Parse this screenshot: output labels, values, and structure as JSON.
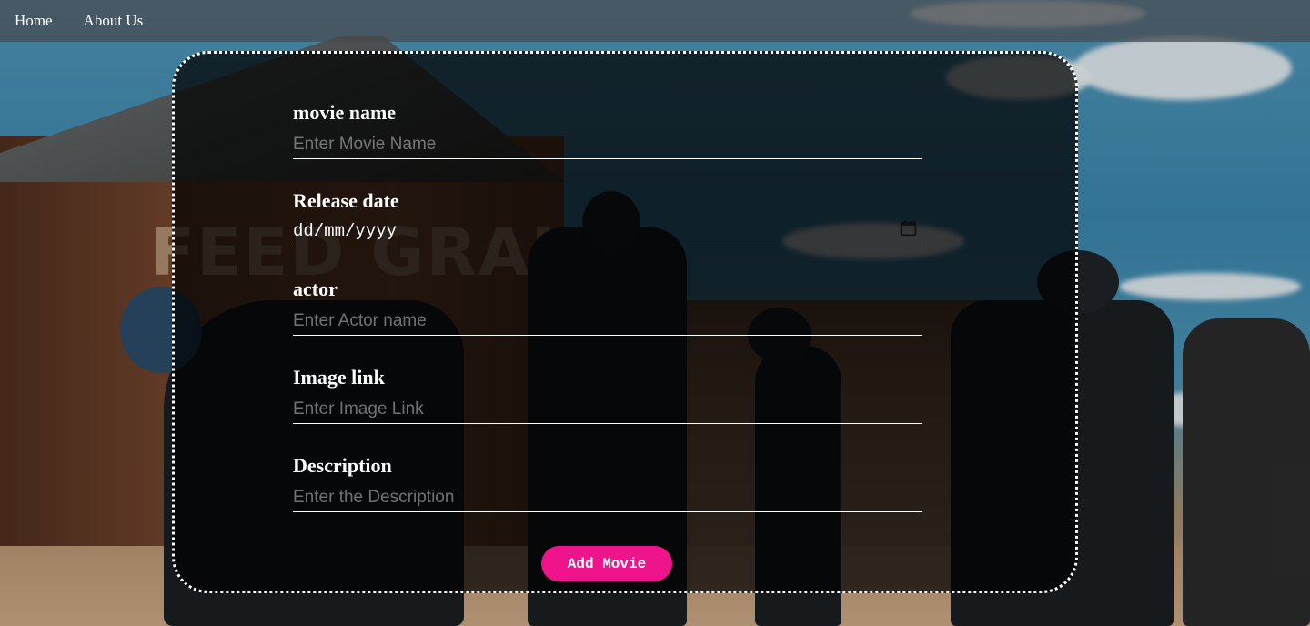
{
  "nav": {
    "items": [
      {
        "label": "Home"
      },
      {
        "label": "About Us"
      }
    ]
  },
  "form": {
    "fields": [
      {
        "label": "movie name",
        "placeholder": "Enter Movie Name"
      },
      {
        "label": "Release date",
        "placeholder": "dd/mm/yyyy"
      },
      {
        "label": "actor",
        "placeholder": "Enter Actor name"
      },
      {
        "label": "Image link",
        "placeholder": "Enter Image Link"
      },
      {
        "label": "Description",
        "placeholder": "Enter the Description"
      }
    ],
    "submit_label": "Add Movie"
  },
  "colors": {
    "accent": "#f0148c",
    "panel_border": "#ffffff",
    "navbar": "#464a4e"
  },
  "icons": {
    "date_picker": "calendar-icon"
  }
}
